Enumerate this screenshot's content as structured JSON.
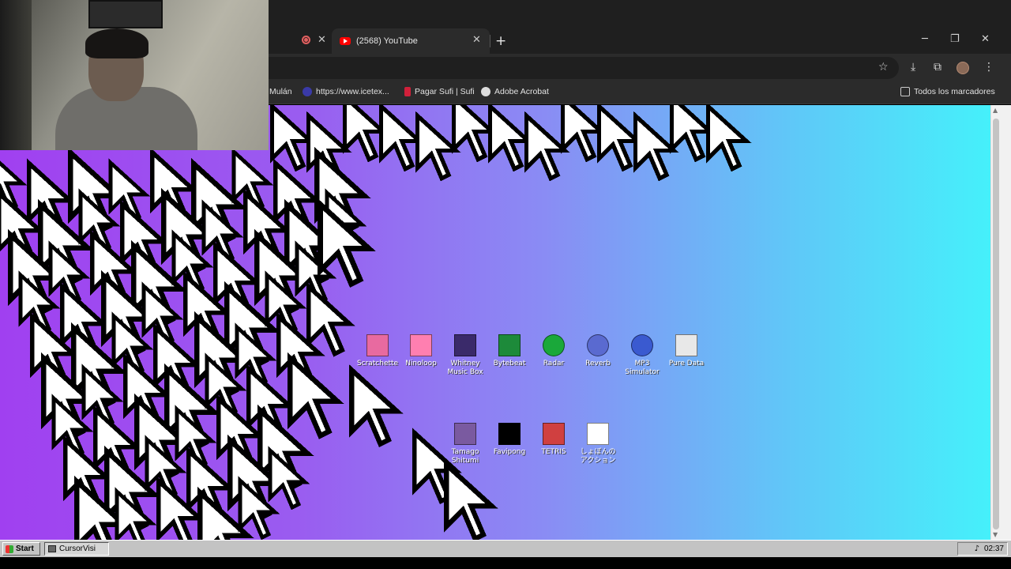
{
  "browser": {
    "tabs": [
      {
        "title": "(2568) YouTube",
        "active": true
      }
    ],
    "new_tab_icon": "plus-icon",
    "window_controls": [
      "minimize-icon",
      "restore-icon",
      "close-icon"
    ],
    "toolbar_icons": [
      "star-icon",
      "download-icon",
      "extensions-icon",
      "avatar",
      "menu-icon"
    ],
    "bookmarks": [
      {
        "label": "Mulán",
        "icon": "none"
      },
      {
        "label": "https://www.icetex...",
        "icon": "eye-icon"
      },
      {
        "label": "Pagar Sufi | Sufi",
        "icon": "sufi-icon"
      },
      {
        "label": "Adobe Acrobat",
        "icon": "acrobat-icon"
      }
    ],
    "bookmarks_folder": "Todos los marcadores"
  },
  "desktop": {
    "background_gradient": [
      "#a040f0",
      "#45f0fa"
    ],
    "icons_row1": [
      {
        "label": "Scratchette",
        "color": "#e86aa0"
      },
      {
        "label": "Ninoloop",
        "color": "#ff7fb0"
      },
      {
        "label": "Whitney\nMusic Box",
        "color": "#3a2a6a"
      },
      {
        "label": "Bytebeat",
        "color": "#1d8a3a"
      },
      {
        "label": "Radar",
        "color": "#1aa83a"
      },
      {
        "label": "Reverb",
        "color": "#5a6ad0"
      },
      {
        "label": "MP3\nSimulator",
        "color": "#3a5ad0"
      },
      {
        "label": "Pure Data",
        "color": "#e8e8e8"
      }
    ],
    "icons_row2": [
      {
        "label": "Tamago\nShitumi",
        "color": "#7a5aa0"
      },
      {
        "label": "Favipong",
        "color": "#000000"
      },
      {
        "label": "TETRIS",
        "color": "#d04040"
      },
      {
        "label": "しょぼんの\nアクション",
        "color": "#ffffff"
      }
    ]
  },
  "taskbar": {
    "start_label": "Start",
    "task_label": "CursorVisi",
    "clock": "02:37"
  },
  "webcam": {
    "present": true
  }
}
